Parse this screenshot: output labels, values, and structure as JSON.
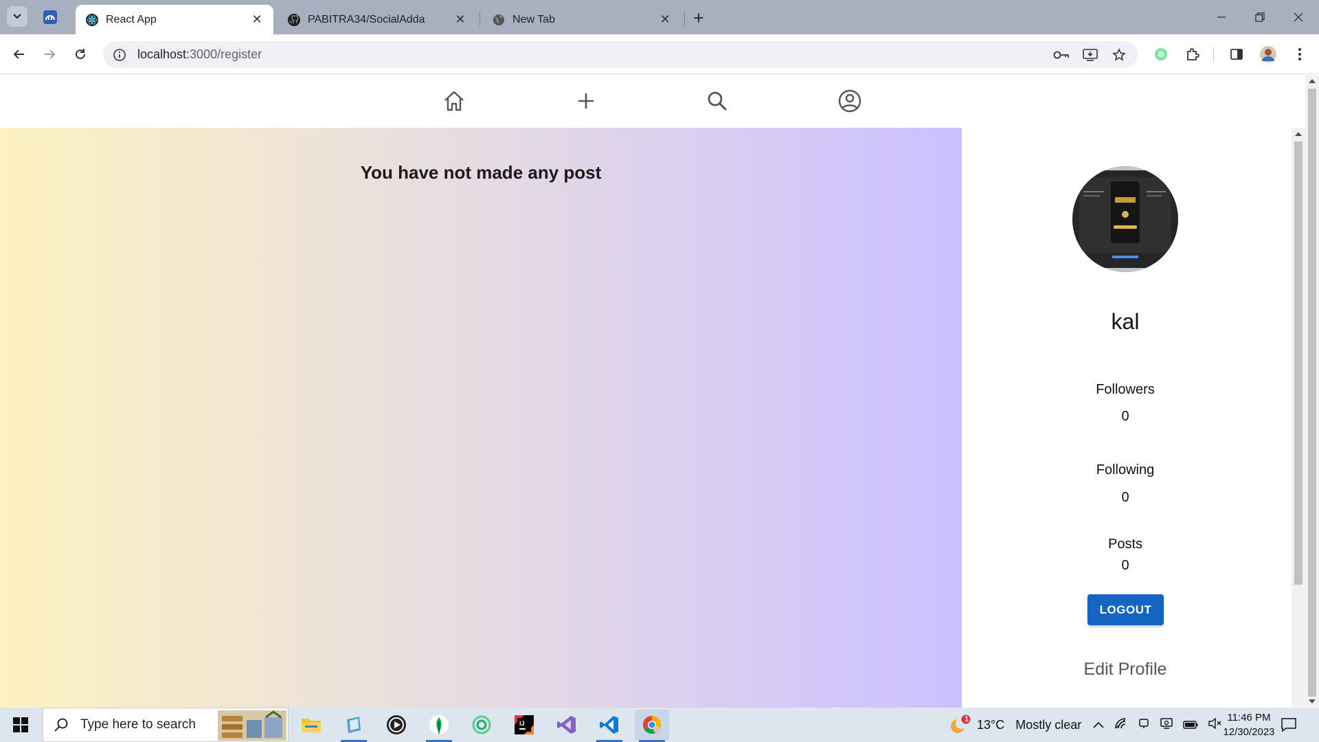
{
  "browser": {
    "tabs": [
      {
        "title": "React App",
        "active": true,
        "icon": "react-icon"
      },
      {
        "title": "PABITRA34/SocialAdda",
        "active": false,
        "icon": "github-icon"
      },
      {
        "title": "New Tab",
        "active": false,
        "icon": "globe-icon"
      }
    ],
    "url_host": "localhost:",
    "url_path": "3000/register"
  },
  "app": {
    "nav_icons": [
      "home-icon",
      "add-icon",
      "search-icon",
      "account-icon"
    ],
    "empty_message": "You have not made any post",
    "profile": {
      "username": "kal",
      "followers_label": "Followers",
      "followers_value": "0",
      "following_label": "Following",
      "following_value": "0",
      "posts_label": "Posts",
      "posts_value": "0",
      "logout_label": "LOGOUT",
      "edit_label": "Edit Profile"
    },
    "colors": {
      "gradient_start": "#fdf2c0",
      "gradient_end": "#cbc0ff",
      "logout_bg": "#1565c0"
    }
  },
  "taskbar": {
    "search_placeholder": "Type here to search",
    "weather_temp": "13°C",
    "weather_desc": "Mostly clear",
    "weather_badge": "1",
    "time": "11:46 PM",
    "date": "12/30/2023"
  }
}
